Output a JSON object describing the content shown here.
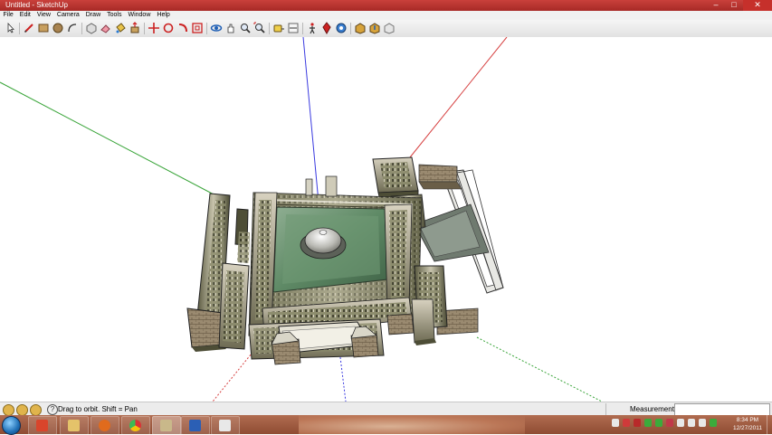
{
  "window": {
    "title": "Untitled - SketchUp"
  },
  "menu": [
    "File",
    "Edit",
    "View",
    "Camera",
    "Draw",
    "Tools",
    "Window",
    "Help"
  ],
  "toolbar": {
    "tools": [
      "select-arrow",
      "pencil-line",
      "rectangle",
      "circle",
      "arc",
      "make-component",
      "eraser",
      "paint-bucket",
      "push-pull",
      "move",
      "rotate",
      "offset",
      "orbit",
      "pan",
      "zoom",
      "zoom-extents",
      "tape-measure",
      "dimension",
      "walk",
      "position-camera",
      "look-around",
      "get-models",
      "share-model",
      "components",
      "materials",
      "styles"
    ]
  },
  "status": {
    "hint": "Drag to orbit.  Shift = Pan",
    "help_glyph": "?",
    "measurements_label": "Measurements",
    "measurements_value": ""
  },
  "taskbar": {
    "apps": [
      "windows-explorer-icon",
      "media-player-icon",
      "file-folder-icon",
      "firefox-icon",
      "chrome-icon",
      "sketchup-task-icon",
      "word-icon",
      "paint-icon"
    ],
    "active_app": "sketchup-task-icon",
    "clock_time": "8:34 PM",
    "clock_date": "12/27/2011"
  },
  "colors": {
    "title_bar": "#b7332e",
    "axis_red": "#d64040",
    "axis_green": "#3aa53a",
    "axis_blue": "#3a3ae0",
    "roof_green": "#5f8a66",
    "taskbar": "#9a583d"
  }
}
